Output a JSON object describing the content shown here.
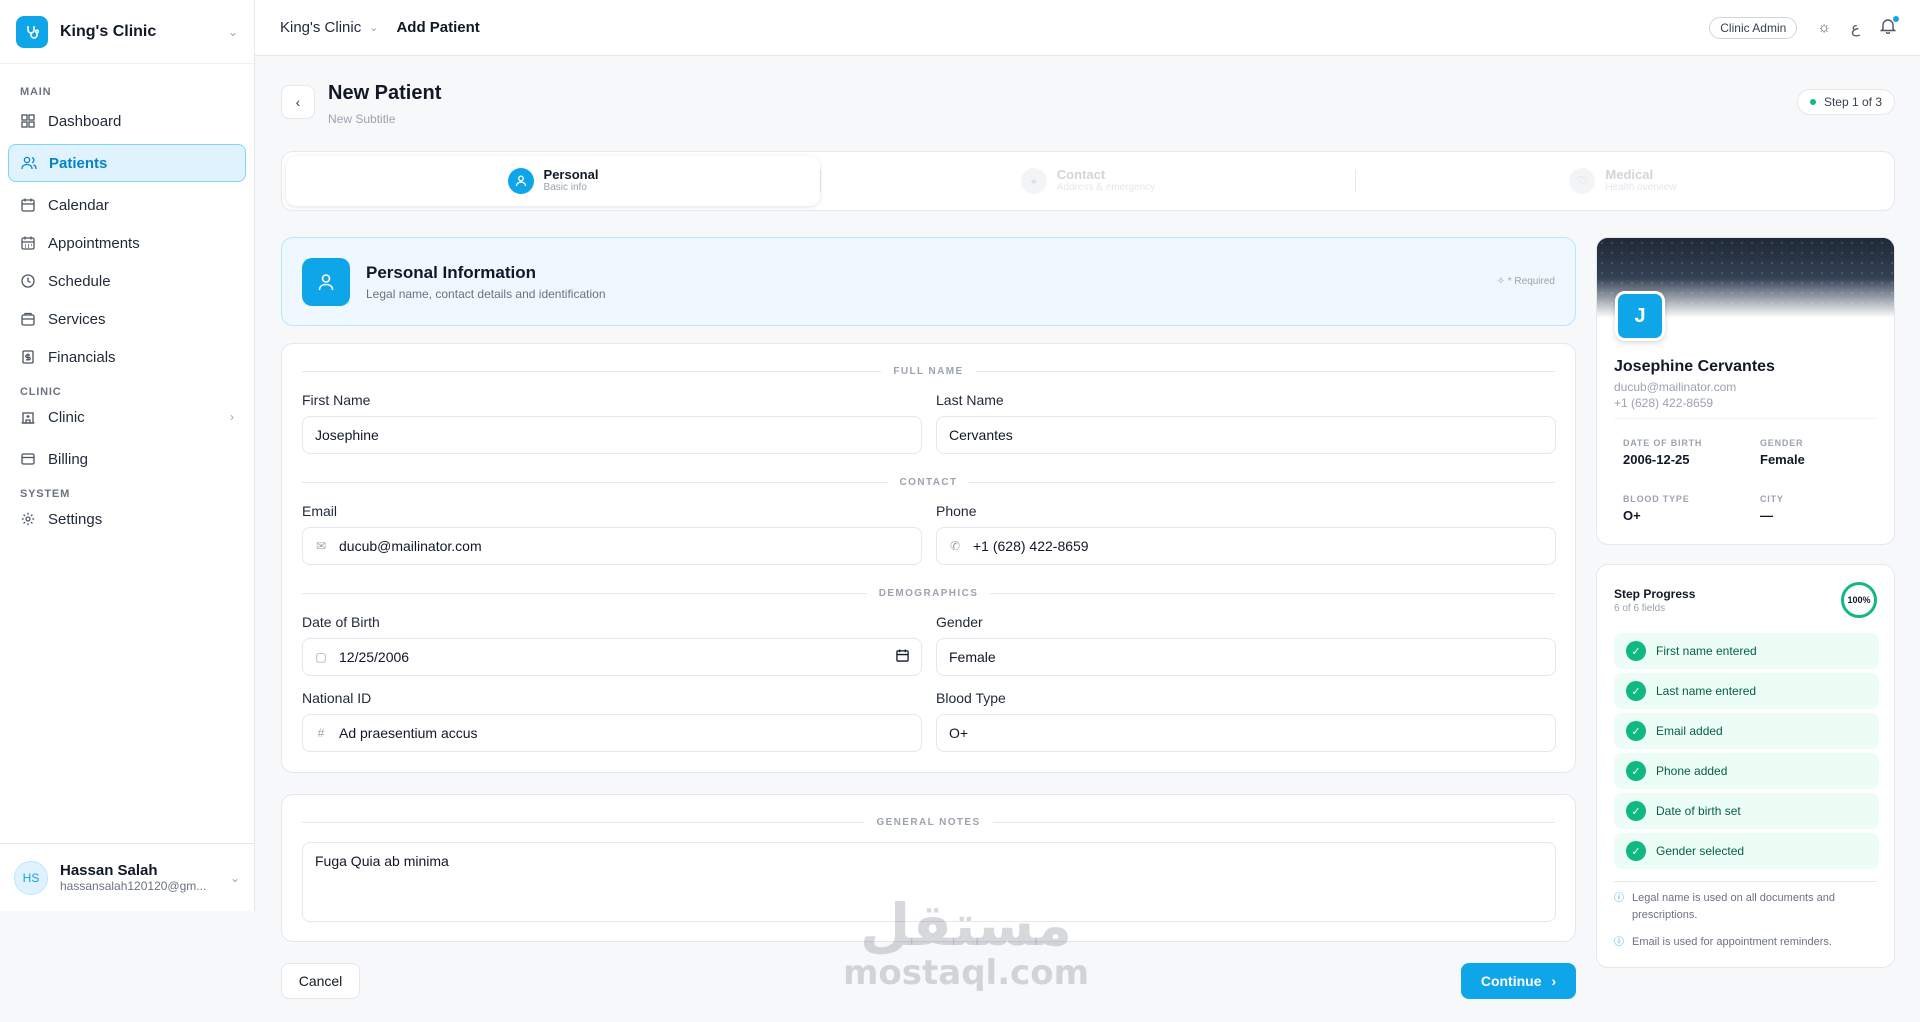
{
  "sidebar": {
    "brand": "King's Clinic",
    "sections": {
      "main": "MAIN",
      "clinic": "CLINIC",
      "system": "SYSTEM"
    },
    "items": {
      "dashboard": "Dashboard",
      "patients": "Patients",
      "calendar": "Calendar",
      "appointments": "Appointments",
      "schedule": "Schedule",
      "services": "Services",
      "financials": "Financials",
      "clinic": "Clinic",
      "billing": "Billing",
      "settings": "Settings"
    },
    "user": {
      "initials": "HS",
      "name": "Hassan Salah",
      "email": "hassansalah120120@gm..."
    }
  },
  "topbar": {
    "breadcrumb_clinic": "King's Clinic",
    "breadcrumb_page": "Add Patient",
    "role": "Clinic Admin",
    "lang": "ع"
  },
  "header": {
    "title": "New Patient",
    "subtitle": "New Subtitle",
    "step_indicator": "Step 1 of 3"
  },
  "stepper": [
    {
      "label": "Personal",
      "sub": "Basic info"
    },
    {
      "label": "Contact",
      "sub": "Address & emergency"
    },
    {
      "label": "Medical",
      "sub": "Health overview"
    }
  ],
  "section": {
    "title": "Personal Information",
    "subtitle": "Legal name, contact details and identification",
    "required": "* Required"
  },
  "form": {
    "groups": {
      "full_name": "FULL NAME",
      "contact": "CONTACT",
      "demographics": "DEMOGRAPHICS",
      "notes": "GENERAL NOTES"
    },
    "first_name": {
      "label": "First Name",
      "value": "Josephine"
    },
    "last_name": {
      "label": "Last Name",
      "value": "Cervantes"
    },
    "email": {
      "label": "Email",
      "value": "ducub@mailinator.com"
    },
    "phone": {
      "label": "Phone",
      "value": "+1 (628) 422-8659"
    },
    "dob": {
      "label": "Date of Birth",
      "value": "12/25/2006"
    },
    "gender": {
      "label": "Gender",
      "value": "Female"
    },
    "national_id": {
      "label": "National ID",
      "value": "Ad praesentium accus"
    },
    "blood_type": {
      "label": "Blood Type",
      "value": "O+"
    },
    "notes": {
      "value": "Fuga Quia ab minima"
    }
  },
  "actions": {
    "cancel": "Cancel",
    "continue": "Continue"
  },
  "preview": {
    "initial": "J",
    "name": "Josephine Cervantes",
    "email": "ducub@mailinator.com",
    "phone": "+1 (628) 422-8659",
    "dob_label": "DATE OF BIRTH",
    "dob": "2006-12-25",
    "gender_label": "GENDER",
    "gender": "Female",
    "blood_label": "BLOOD TYPE",
    "blood": "O+",
    "city_label": "CITY",
    "city": "—"
  },
  "progress": {
    "title": "Step Progress",
    "sub": "6 of 6 fields",
    "percent": "100%",
    "items": [
      "First name entered",
      "Last name entered",
      "Email added",
      "Phone added",
      "Date of birth set",
      "Gender selected"
    ],
    "tips": [
      "Legal name is used on all documents and prescriptions.",
      "Email is used for appointment reminders."
    ]
  },
  "watermark": {
    "arabic": "مستقل",
    "latin": "mostaql.com"
  },
  "colors": {
    "accent": "#0ea5e9",
    "success": "#10b981"
  }
}
